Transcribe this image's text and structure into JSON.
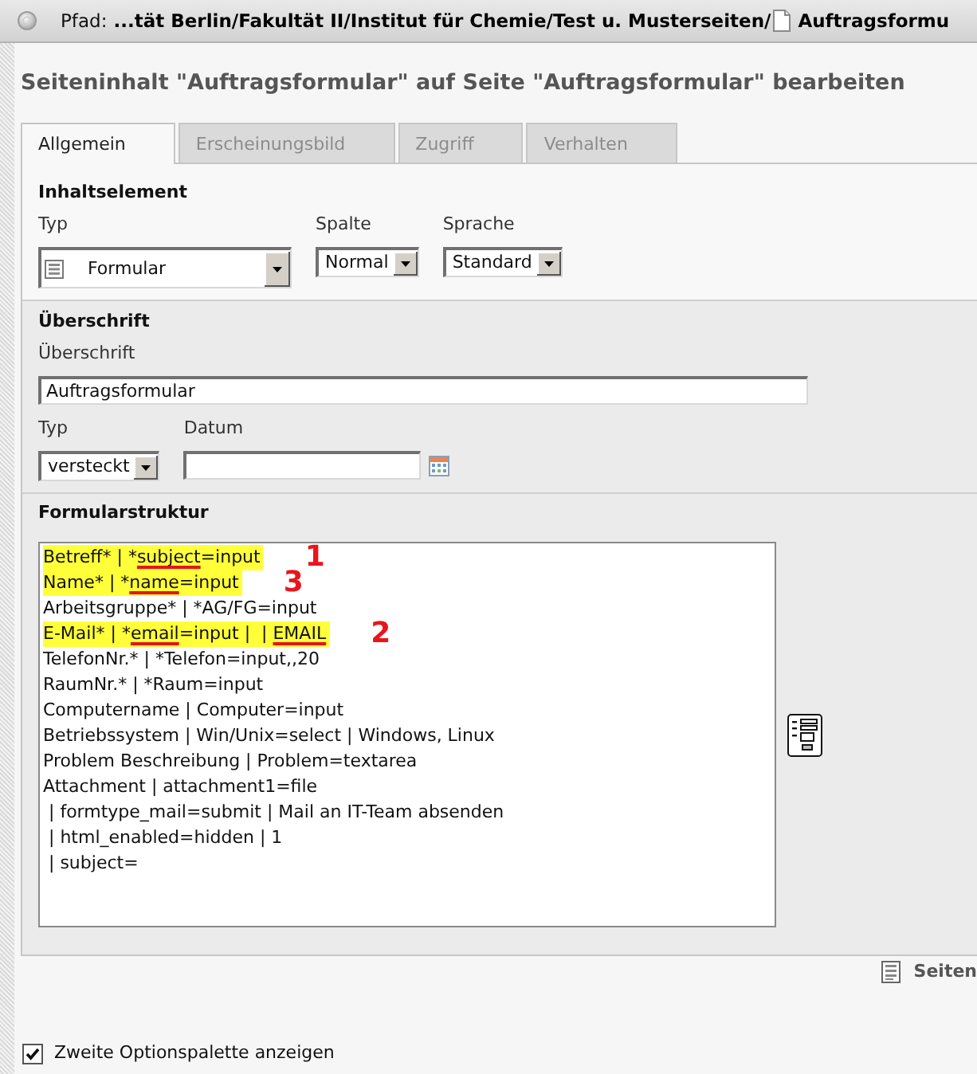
{
  "top_bar": {
    "label": "Pfad:",
    "path": "...tät Berlin/Fakultät II/Institut für Chemie/Test u. Musterseiten/",
    "page": "Auftragsformu"
  },
  "heading": "Seiteninhalt \"Auftragsformular\" auf Seite \"Auftragsformular\" bearbeiten",
  "tabs": [
    {
      "label": "Allgemein",
      "selected": true
    },
    {
      "label": "Erscheinungsbild",
      "selected": false
    },
    {
      "label": "Zugriff",
      "selected": false
    },
    {
      "label": "Verhalten",
      "selected": false
    }
  ],
  "content_element": {
    "title": "Inhaltselement",
    "type": {
      "label": "Typ",
      "value": "Formular"
    },
    "column": {
      "label": "Spalte",
      "value": "Normal"
    },
    "language": {
      "label": "Sprache",
      "value": "Standard"
    }
  },
  "header_section": {
    "title": "Überschrift",
    "header": {
      "label": "Überschrift",
      "value": "Auftragsformular"
    },
    "type": {
      "label": "Typ",
      "value": "versteckt"
    },
    "date": {
      "label": "Datum"
    }
  },
  "form_structure": {
    "title": "Formularstruktur",
    "lines": [
      {
        "highlighted": true,
        "annotation": "1",
        "segments": [
          {
            "text": "Betreff* | *",
            "underlined": false
          },
          {
            "text": "subject",
            "underlined": true
          },
          {
            "text": "=input",
            "underlined": false
          }
        ]
      },
      {
        "highlighted": true,
        "annotation": "3",
        "segments": [
          {
            "text": "Name* | *",
            "underlined": false
          },
          {
            "text": "name",
            "underlined": true
          },
          {
            "text": "=input",
            "underlined": false
          }
        ]
      },
      {
        "highlighted": false,
        "segments": [
          {
            "text": "Arbeitsgruppe* | *AG/FG=input",
            "underlined": false
          }
        ]
      },
      {
        "highlighted": true,
        "annotation": "2",
        "segments": [
          {
            "text": "E-Mail* | *",
            "underlined": false
          },
          {
            "text": "email",
            "underlined": true
          },
          {
            "text": "=input |  | ",
            "underlined": false
          },
          {
            "text": "EMAIL",
            "underlined": true
          }
        ]
      },
      {
        "highlighted": false,
        "segments": [
          {
            "text": "TelefonNr.* | *Telefon=input,,20",
            "underlined": false
          }
        ]
      },
      {
        "highlighted": false,
        "segments": [
          {
            "text": "RaumNr.* | *Raum=input",
            "underlined": false
          }
        ]
      },
      {
        "highlighted": false,
        "segments": [
          {
            "text": "Computername | Computer=input",
            "underlined": false
          }
        ]
      },
      {
        "highlighted": false,
        "segments": [
          {
            "text": "Betriebssystem | Win/Unix=select | Windows, Linux",
            "underlined": false
          }
        ]
      },
      {
        "highlighted": false,
        "segments": [
          {
            "text": "Problem Beschreibung | Problem=textarea",
            "underlined": false
          }
        ]
      },
      {
        "highlighted": false,
        "segments": [
          {
            "text": "Attachment | attachment1=file",
            "underlined": false
          }
        ]
      },
      {
        "highlighted": false,
        "segments": [
          {
            "text": " | formtype_mail=submit | Mail an IT-Team absenden",
            "underlined": false
          }
        ]
      },
      {
        "highlighted": false,
        "segments": [
          {
            "text": " | html_enabled=hidden | 1",
            "underlined": false
          }
        ]
      },
      {
        "highlighted": false,
        "segments": [
          {
            "text": " | subject=",
            "underlined": false
          }
        ]
      }
    ]
  },
  "page_module_link": "Seiten",
  "second_options": {
    "label": "Zweite Optionspalette anzeigen",
    "checked": true
  }
}
